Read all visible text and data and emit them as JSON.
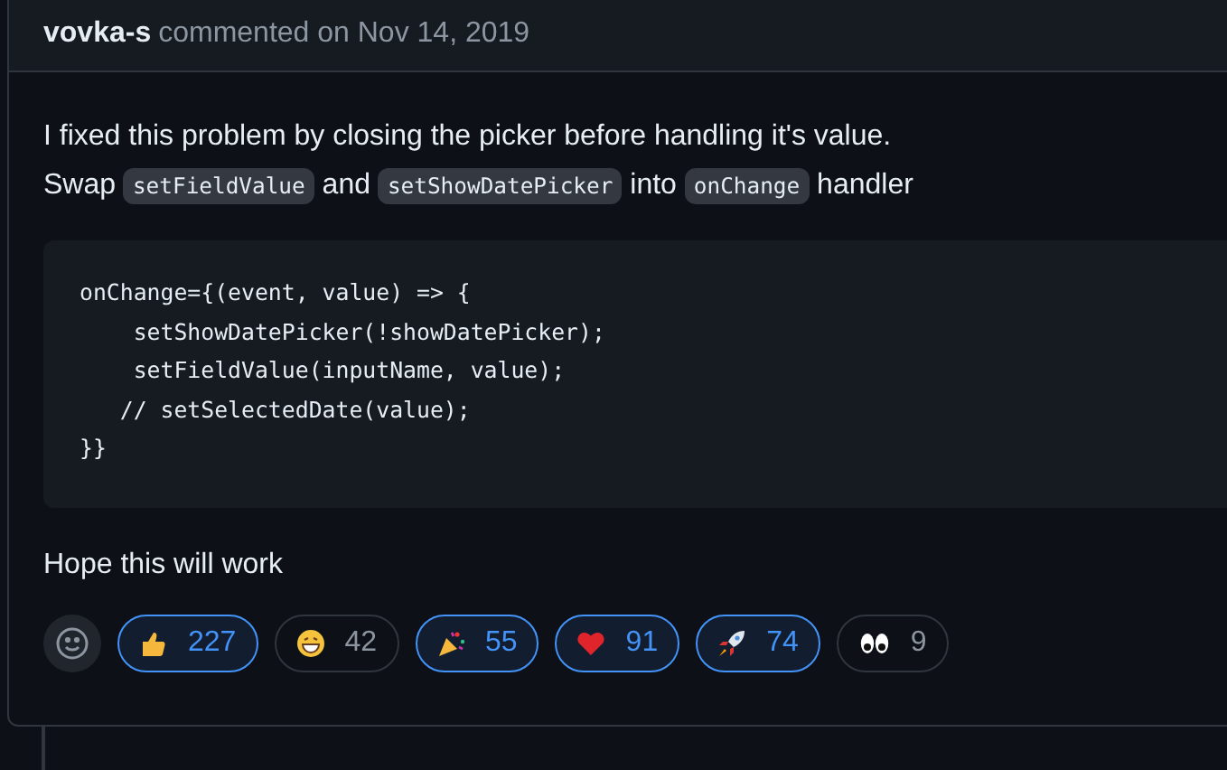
{
  "comment": {
    "author": "vovka-s",
    "action": "commented on Nov 14, 2019",
    "paragraph": [
      [
        {
          "kind": "text",
          "text": "I fixed this problem by closing the picker before handling it's value."
        }
      ],
      [
        {
          "kind": "text",
          "text": "Swap "
        },
        {
          "kind": "code",
          "text": "setFieldValue"
        },
        {
          "kind": "text",
          "text": " and "
        },
        {
          "kind": "code",
          "text": "setShowDatePicker"
        },
        {
          "kind": "text",
          "text": " into "
        },
        {
          "kind": "code",
          "text": "onChange"
        },
        {
          "kind": "text",
          "text": " handler"
        }
      ]
    ],
    "code_block": [
      "onChange={(event, value) => {",
      "    setShowDatePicker(!showDatePicker);",
      "    setFieldValue(inputName, value);",
      "   // setSelectedDate(value);",
      "}}"
    ],
    "closing": "Hope this will work",
    "reactions": [
      {
        "kind": "thumbs_up",
        "count": "227",
        "selected": true
      },
      {
        "kind": "laugh",
        "count": "42",
        "selected": false
      },
      {
        "kind": "hooray",
        "count": "55",
        "selected": true
      },
      {
        "kind": "heart",
        "count": "91",
        "selected": true
      },
      {
        "kind": "rocket",
        "count": "74",
        "selected": true
      },
      {
        "kind": "eyes",
        "count": "9",
        "selected": false
      }
    ]
  }
}
